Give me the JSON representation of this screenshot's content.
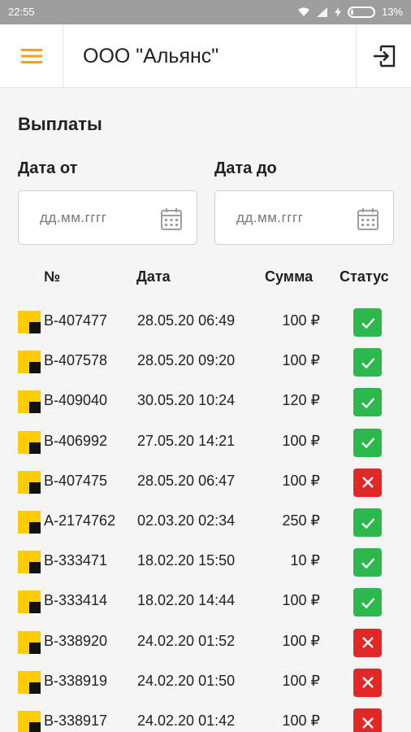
{
  "status_bar": {
    "time": "22:55",
    "battery": "13%",
    "battery_level": 0.13
  },
  "app_bar": {
    "title": "ООО \"Альянс\""
  },
  "page": {
    "title": "Выплаты"
  },
  "filters": {
    "from_label": "Дата от",
    "to_label": "Дата до",
    "from_placeholder": "дд.мм.гггг",
    "to_placeholder": "дд.мм.гггг"
  },
  "table": {
    "headers": {
      "number": "№",
      "date": "Дата",
      "sum": "Сумма",
      "status": "Статус"
    },
    "rows": [
      {
        "number": "В-407477",
        "date": "28.05.20 06:49",
        "sum": "100 ₽",
        "status": "ok"
      },
      {
        "number": "В-407578",
        "date": "28.05.20 09:20",
        "sum": "100 ₽",
        "status": "ok"
      },
      {
        "number": "В-409040",
        "date": "30.05.20 10:24",
        "sum": "120 ₽",
        "status": "ok"
      },
      {
        "number": "В-406992",
        "date": "27.05.20 14:21",
        "sum": "100 ₽",
        "status": "ok"
      },
      {
        "number": "В-407475",
        "date": "28.05.20 06:47",
        "sum": "100 ₽",
        "status": "fail"
      },
      {
        "number": "А-2174762",
        "date": "02.03.20 02:34",
        "sum": "250 ₽",
        "status": "ok"
      },
      {
        "number": "В-333471",
        "date": "18.02.20 15:50",
        "sum": "10 ₽",
        "status": "ok"
      },
      {
        "number": "В-333414",
        "date": "18.02.20 14:44",
        "sum": "100 ₽",
        "status": "ok"
      },
      {
        "number": "В-338920",
        "date": "24.02.20 01:52",
        "sum": "100 ₽",
        "status": "fail"
      },
      {
        "number": "В-338919",
        "date": "24.02.20 01:50",
        "sum": "100 ₽",
        "status": "fail"
      },
      {
        "number": "В-338917",
        "date": "24.02.20 01:42",
        "sum": "100 ₽",
        "status": "fail"
      }
    ]
  },
  "colors": {
    "accent": "#f7a21b",
    "ok": "#2db84d",
    "fail": "#e02828",
    "logo_yellow": "#ffcc00"
  }
}
